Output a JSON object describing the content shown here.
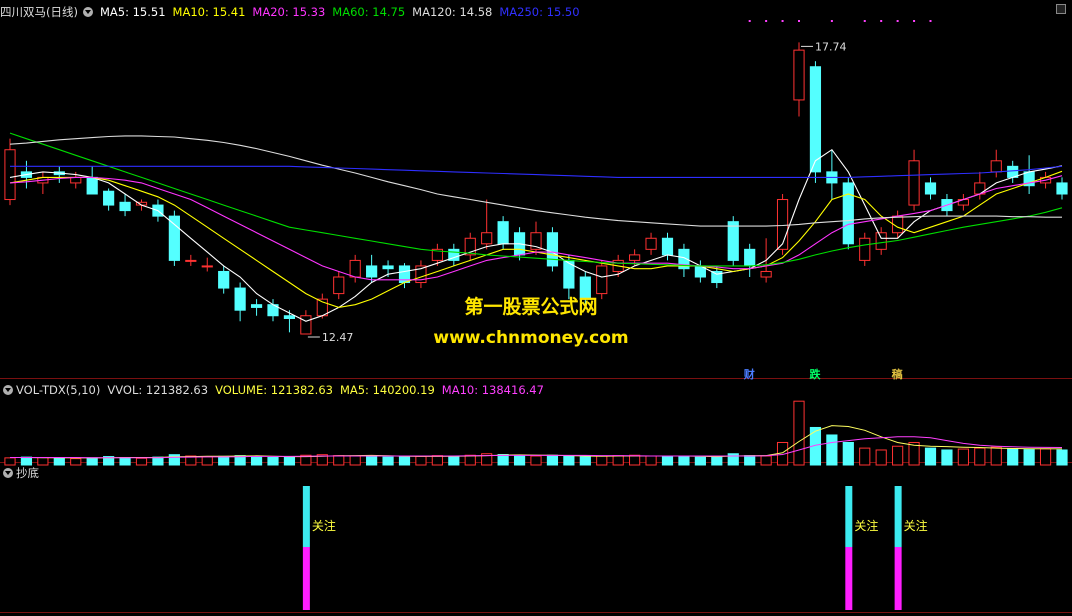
{
  "colors": {
    "bg": "#000000",
    "up": "#ff3232",
    "down": "#54ffff",
    "ma5": "#ffffff",
    "ma10": "#ffff00",
    "ma20": "#ff35ff",
    "ma60": "#00dd00",
    "ma120": "#dddddd",
    "ma250": "#2e2eff",
    "label": "#c8c8c8",
    "vol_ma5": "#ffff60",
    "vol_ma10": "#ff40ff",
    "signal_top": "#3ceaf0",
    "signal_bottom": "#ff1eff",
    "signal_text": "#ffff40"
  },
  "main_header": {
    "title": "四川双马(日线)",
    "items": [
      {
        "label": "MA5: 15.51",
        "color": "#ffffff"
      },
      {
        "label": "MA10: 15.41",
        "color": "#ffff00"
      },
      {
        "label": "MA20: 15.33",
        "color": "#ff35ff"
      },
      {
        "label": "MA60: 14.75",
        "color": "#00dd00"
      },
      {
        "label": "MA120: 14.58",
        "color": "#dddddd"
      },
      {
        "label": "MA250: 15.50",
        "color": "#3030ff"
      }
    ]
  },
  "volume_header": {
    "title": "VOL-TDX(5,10)",
    "items": [
      {
        "label": "VVOL: 121382.63",
        "color": "#dddddd"
      },
      {
        "label": "VOLUME: 121382.63",
        "color": "#ffff40"
      },
      {
        "label": "MA5: 140200.19",
        "color": "#ffff40"
      },
      {
        "label": "MA10: 138416.47",
        "color": "#ff40ff"
      }
    ]
  },
  "signal_header": {
    "title": "抄底"
  },
  "watermark": {
    "line1": "第一股票公式网",
    "line2": "www.chnmoney.com"
  },
  "event_marks": [
    {
      "label": "财",
      "index": 45,
      "color": "#4a7cff"
    },
    {
      "label": "跌",
      "index": 49,
      "color": "#00ff66"
    },
    {
      "label": "稿",
      "index": 54,
      "color": "#e0c040"
    }
  ],
  "chart_data": [
    {
      "type": "candlestick",
      "panel": "price",
      "high_label": "17.74",
      "low_label": "12.47",
      "ylim": [
        12.0,
        18.0
      ],
      "candles": [
        [
          14.9,
          15.8,
          14.8,
          16.0
        ],
        [
          15.4,
          15.3,
          15.1,
          15.6
        ],
        [
          15.2,
          15.3,
          15.0,
          15.4
        ],
        [
          15.4,
          15.35,
          15.2,
          15.5
        ],
        [
          15.2,
          15.3,
          15.1,
          15.4
        ],
        [
          15.3,
          15.0,
          15.0,
          15.5
        ],
        [
          15.05,
          14.8,
          14.7,
          15.1
        ],
        [
          14.85,
          14.7,
          14.6,
          15.0
        ],
        [
          14.8,
          14.85,
          14.7,
          14.9
        ],
        [
          14.8,
          14.6,
          14.5,
          14.9
        ],
        [
          14.6,
          13.8,
          13.7,
          14.7
        ],
        [
          13.8,
          13.8,
          13.7,
          13.9
        ],
        [
          13.7,
          13.7,
          13.6,
          13.85
        ],
        [
          13.6,
          13.3,
          13.2,
          13.7
        ],
        [
          13.3,
          12.9,
          12.7,
          13.4
        ],
        [
          13.0,
          12.95,
          12.8,
          13.1
        ],
        [
          13.0,
          12.8,
          12.7,
          13.1
        ],
        [
          12.8,
          12.75,
          12.5,
          12.9
        ],
        [
          12.47,
          12.8,
          12.47,
          12.9
        ],
        [
          12.8,
          13.1,
          12.75,
          13.2
        ],
        [
          13.2,
          13.5,
          13.1,
          13.6
        ],
        [
          13.5,
          13.8,
          13.4,
          13.9
        ],
        [
          13.7,
          13.5,
          13.4,
          13.9
        ],
        [
          13.7,
          13.65,
          13.5,
          13.8
        ],
        [
          13.7,
          13.4,
          13.3,
          13.75
        ],
        [
          13.4,
          13.7,
          13.3,
          13.8
        ],
        [
          13.8,
          14.0,
          13.7,
          14.1
        ],
        [
          14.0,
          13.8,
          13.7,
          14.1
        ],
        [
          13.9,
          14.2,
          13.8,
          14.3
        ],
        [
          14.1,
          14.3,
          14.0,
          14.9
        ],
        [
          14.5,
          14.1,
          14.0,
          14.6
        ],
        [
          14.3,
          13.9,
          13.8,
          14.4
        ],
        [
          14.0,
          14.3,
          13.9,
          14.5
        ],
        [
          14.3,
          13.7,
          13.6,
          14.4
        ],
        [
          13.8,
          13.3,
          13.1,
          13.9
        ],
        [
          13.5,
          13.1,
          13.0,
          13.6
        ],
        [
          13.2,
          13.7,
          13.1,
          13.8
        ],
        [
          13.6,
          13.8,
          13.5,
          13.9
        ],
        [
          13.8,
          13.9,
          13.7,
          14.0
        ],
        [
          14.0,
          14.2,
          13.9,
          14.3
        ],
        [
          14.2,
          13.9,
          13.8,
          14.3
        ],
        [
          14.0,
          13.65,
          13.5,
          14.1
        ],
        [
          13.7,
          13.5,
          13.4,
          13.8
        ],
        [
          13.6,
          13.4,
          13.3,
          13.7
        ],
        [
          14.5,
          13.8,
          13.7,
          14.6
        ],
        [
          14.0,
          13.7,
          13.5,
          14.1
        ],
        [
          13.5,
          13.6,
          13.4,
          14.2
        ],
        [
          14.0,
          14.9,
          13.9,
          15.0
        ],
        [
          16.7,
          17.6,
          16.4,
          17.74
        ],
        [
          17.3,
          15.4,
          15.2,
          17.4
        ],
        [
          15.4,
          15.2,
          14.9,
          15.8
        ],
        [
          15.2,
          14.1,
          14.0,
          15.3
        ],
        [
          13.8,
          14.2,
          13.7,
          14.3
        ],
        [
          14.0,
          14.3,
          13.9,
          14.4
        ],
        [
          14.3,
          14.6,
          14.2,
          14.7
        ],
        [
          14.8,
          15.6,
          14.7,
          15.8
        ],
        [
          15.2,
          15.0,
          14.9,
          15.3
        ],
        [
          14.9,
          14.7,
          14.6,
          15.0
        ],
        [
          14.8,
          14.9,
          14.7,
          15.0
        ],
        [
          15.0,
          15.2,
          14.9,
          15.4
        ],
        [
          15.4,
          15.6,
          15.3,
          15.8
        ],
        [
          15.5,
          15.3,
          15.2,
          15.6
        ],
        [
          15.4,
          15.15,
          15.0,
          15.7
        ],
        [
          15.2,
          15.3,
          15.1,
          15.4
        ],
        [
          15.2,
          15.0,
          14.9,
          15.3
        ]
      ],
      "ma_series": [
        {
          "name": "MA5",
          "color": "#ffffff",
          "values": [
            15.3,
            15.35,
            15.4,
            15.38,
            15.35,
            15.3,
            15.2,
            15.0,
            14.8,
            14.7,
            14.45,
            14.2,
            13.95,
            13.7,
            13.5,
            13.2,
            13.0,
            12.85,
            12.7,
            12.8,
            12.95,
            13.15,
            13.4,
            13.55,
            13.6,
            13.65,
            13.75,
            13.85,
            13.95,
            14.05,
            14.1,
            14.1,
            14.05,
            13.95,
            13.75,
            13.6,
            13.5,
            13.55,
            13.7,
            13.8,
            13.9,
            13.85,
            13.7,
            13.55,
            13.6,
            13.65,
            13.8,
            14.1,
            14.9,
            15.6,
            15.8,
            15.4,
            14.8,
            14.2,
            14.2,
            14.5,
            14.7,
            14.8,
            14.9,
            15.0,
            15.2,
            15.3,
            15.4,
            15.45,
            15.51
          ]
        },
        {
          "name": "MA10",
          "color": "#ffff00",
          "values": [
            15.2,
            15.25,
            15.3,
            15.3,
            15.3,
            15.3,
            15.25,
            15.15,
            15.05,
            14.95,
            14.8,
            14.6,
            14.4,
            14.2,
            14.0,
            13.8,
            13.6,
            13.4,
            13.2,
            13.05,
            12.95,
            13.0,
            13.1,
            13.25,
            13.4,
            13.5,
            13.6,
            13.7,
            13.8,
            13.9,
            14.0,
            14.0,
            13.95,
            13.9,
            13.85,
            13.8,
            13.75,
            13.7,
            13.65,
            13.65,
            13.7,
            13.7,
            13.7,
            13.65,
            13.6,
            13.65,
            13.7,
            13.85,
            14.15,
            14.5,
            14.9,
            15.0,
            14.9,
            14.6,
            14.4,
            14.3,
            14.4,
            14.5,
            14.6,
            14.8,
            15.0,
            15.1,
            15.2,
            15.3,
            15.41
          ]
        },
        {
          "name": "MA20",
          "color": "#ff35ff",
          "values": [
            15.2,
            15.22,
            15.25,
            15.28,
            15.3,
            15.3,
            15.28,
            15.25,
            15.2,
            15.1,
            15.0,
            14.9,
            14.75,
            14.6,
            14.45,
            14.3,
            14.15,
            14.0,
            13.85,
            13.7,
            13.6,
            13.5,
            13.45,
            13.45,
            13.45,
            13.45,
            13.5,
            13.6,
            13.7,
            13.8,
            13.85,
            13.9,
            13.95,
            13.95,
            13.9,
            13.85,
            13.8,
            13.75,
            13.75,
            13.75,
            13.75,
            13.72,
            13.7,
            13.68,
            13.65,
            13.65,
            13.7,
            13.75,
            13.9,
            14.1,
            14.3,
            14.45,
            14.5,
            14.55,
            14.6,
            14.65,
            14.7,
            14.8,
            14.9,
            15.0,
            15.1,
            15.15,
            15.2,
            15.25,
            15.33
          ]
        },
        {
          "name": "MA60",
          "color": "#00dd00",
          "values": [
            16.1,
            16.0,
            15.9,
            15.8,
            15.7,
            15.6,
            15.5,
            15.4,
            15.3,
            15.2,
            15.1,
            15.0,
            14.9,
            14.8,
            14.7,
            14.6,
            14.5,
            14.4,
            14.35,
            14.3,
            14.25,
            14.2,
            14.15,
            14.1,
            14.05,
            14.0,
            13.97,
            13.95,
            13.93,
            13.9,
            13.88,
            13.86,
            13.84,
            13.82,
            13.8,
            13.78,
            13.76,
            13.75,
            13.74,
            13.73,
            13.72,
            13.71,
            13.7,
            13.7,
            13.7,
            13.7,
            13.72,
            13.76,
            13.82,
            13.9,
            13.97,
            14.03,
            14.08,
            14.12,
            14.16,
            14.22,
            14.28,
            14.34,
            14.4,
            14.45,
            14.5,
            14.55,
            14.6,
            14.67,
            14.75
          ]
        },
        {
          "name": "MA120",
          "color": "#dddddd",
          "values": [
            15.9,
            15.92,
            15.95,
            15.98,
            16.0,
            16.02,
            16.04,
            16.05,
            16.05,
            16.04,
            16.03,
            16.0,
            15.97,
            15.93,
            15.88,
            15.82,
            15.75,
            15.68,
            15.6,
            15.52,
            15.45,
            15.38,
            15.3,
            15.22,
            15.15,
            15.08,
            15.0,
            14.95,
            14.9,
            14.85,
            14.8,
            14.75,
            14.7,
            14.66,
            14.62,
            14.58,
            14.55,
            14.52,
            14.5,
            14.48,
            14.46,
            14.44,
            14.42,
            14.42,
            14.42,
            14.42,
            14.42,
            14.43,
            14.45,
            14.48,
            14.5,
            14.52,
            14.55,
            14.57,
            14.58,
            14.59,
            14.6,
            14.6,
            14.6,
            14.6,
            14.6,
            14.59,
            14.59,
            14.58,
            14.58
          ]
        },
        {
          "name": "MA250",
          "color": "#2e2eff",
          "values": [
            15.5,
            15.5,
            15.5,
            15.5,
            15.5,
            15.5,
            15.5,
            15.5,
            15.5,
            15.5,
            15.5,
            15.5,
            15.5,
            15.5,
            15.5,
            15.5,
            15.5,
            15.5,
            15.49,
            15.48,
            15.47,
            15.46,
            15.45,
            15.44,
            15.43,
            15.42,
            15.41,
            15.4,
            15.39,
            15.38,
            15.37,
            15.36,
            15.35,
            15.34,
            15.33,
            15.32,
            15.31,
            15.3,
            15.3,
            15.3,
            15.3,
            15.3,
            15.3,
            15.3,
            15.3,
            15.3,
            15.3,
            15.3,
            15.3,
            15.3,
            15.3,
            15.3,
            15.31,
            15.32,
            15.33,
            15.34,
            15.35,
            15.36,
            15.37,
            15.38,
            15.4,
            15.42,
            15.44,
            15.47,
            15.5
          ]
        }
      ]
    },
    {
      "type": "bar",
      "panel": "volume",
      "values": [
        38,
        42,
        40,
        36,
        34,
        38,
        45,
        40,
        36,
        42,
        55,
        48,
        44,
        46,
        50,
        42,
        40,
        44,
        52,
        55,
        50,
        48,
        46,
        42,
        44,
        46,
        50,
        48,
        52,
        60,
        56,
        50,
        48,
        52,
        46,
        44,
        48,
        50,
        52,
        48,
        46,
        44,
        42,
        44,
        60,
        50,
        48,
        120,
        340,
        200,
        160,
        120,
        90,
        80,
        100,
        120,
        90,
        80,
        85,
        90,
        95,
        88,
        82,
        86,
        80
      ],
      "ma5": [
        40,
        40,
        39,
        39,
        38,
        38,
        39,
        40,
        40,
        40,
        44,
        45,
        47,
        47,
        48,
        49,
        47,
        45,
        45,
        47,
        49,
        50,
        51,
        49,
        47,
        46,
        46,
        47,
        48,
        50,
        53,
        54,
        53,
        52,
        50,
        48,
        47,
        48,
        48,
        48,
        48,
        48,
        47,
        45,
        48,
        49,
        50,
        65,
        125,
        180,
        210,
        205,
        185,
        150,
        120,
        105,
        100,
        98,
        95,
        93,
        90,
        88,
        87,
        87,
        86
      ],
      "ma10": [
        40,
        40,
        40,
        40,
        40,
        39,
        39,
        39,
        39,
        39,
        41,
        42,
        43,
        43,
        44,
        46,
        46,
        46,
        47,
        48,
        48,
        48,
        48,
        48,
        48,
        48,
        48,
        48,
        49,
        50,
        51,
        51,
        51,
        51,
        51,
        51,
        50,
        50,
        49,
        48,
        48,
        48,
        48,
        48,
        48,
        48,
        49,
        56,
        80,
        105,
        120,
        130,
        140,
        145,
        150,
        150,
        145,
        130,
        115,
        105,
        100,
        97,
        95,
        94,
        93
      ]
    },
    {
      "type": "bar",
      "panel": "signal",
      "signal_label": "关注",
      "signals": [
        18,
        51,
        54
      ]
    }
  ]
}
